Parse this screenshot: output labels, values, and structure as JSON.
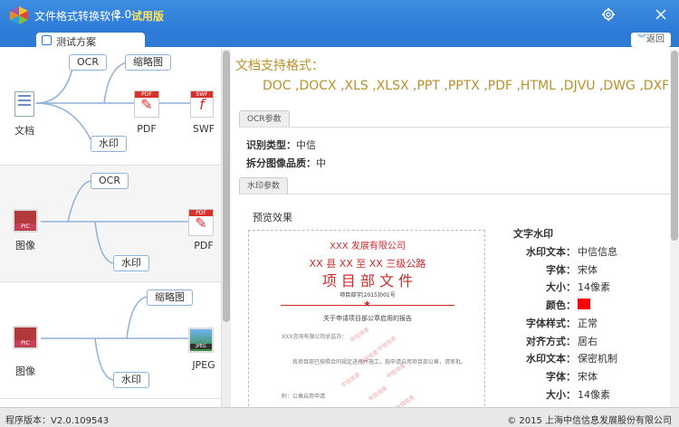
{
  "titlebar": {
    "app_name": "文件格式转换软件",
    "version": "2.0",
    "trial": "试用版",
    "settings_icon": "gear-icon",
    "close_icon": "close-icon"
  },
  "tabs": [
    {
      "label": "测试方案",
      "icon": "document-icon"
    }
  ],
  "back_label": "返回",
  "schemes": [
    {
      "source": "文档",
      "branches": [
        "OCR",
        "缩略图",
        "水印"
      ],
      "targets": [
        "PDF",
        "SWF"
      ]
    },
    {
      "source": "图像",
      "branches": [
        "OCR",
        "水印"
      ],
      "targets": [
        "PDF"
      ]
    },
    {
      "source": "图像",
      "branches": [
        "缩略图",
        "水印"
      ],
      "targets": [
        "JPEG"
      ]
    }
  ],
  "formats": {
    "title": "文档支持格式：",
    "list": "DOC ,DOCX ,XLS ,XLSX ,PPT ,PPTX ,PDF ,HTML ,DJVU ,DWG ,DXF"
  },
  "ocr": {
    "tab_label": "OCR参数",
    "type_label": "识别类型：",
    "type_value": "中信",
    "split_label": "拆分图像品质：",
    "split_value": "中"
  },
  "watermark": {
    "tab_label": "水印参数",
    "preview_label": "预览效果",
    "panel_title": "文字水印",
    "rows": [
      {
        "key": "水印文本：",
        "value": "中信信息"
      },
      {
        "key": "字体：",
        "value": "宋体"
      },
      {
        "key": "大小：",
        "value": "14像素"
      },
      {
        "key": "颜色：",
        "value": ""
      },
      {
        "key": "字体样式：",
        "value": "正常"
      },
      {
        "key": "对齐方式：",
        "value": "居右"
      },
      {
        "key": "水印文本：",
        "value": "保密机制"
      },
      {
        "key": "字体：",
        "value": "宋体"
      },
      {
        "key": "大小：",
        "value": "14像素"
      }
    ],
    "color_swatch": "#ff0000"
  },
  "preview_doc": {
    "company": "XXX 发展有限公司",
    "project_line": "XX 县 XX 至 XX 三级公路",
    "heading": "项 目 部 文 件",
    "doc_number": "项目部字[2015]001号",
    "subject": "关于申请项目部公章启用的报告",
    "to": "XXX咨询有限公司总监办：",
    "body": "我项目部已按照合同规定进场并施工，现申请启用项目部公章，请审批。",
    "note": "附：公章启用申请",
    "watermark_text": "中信信息"
  },
  "status": {
    "left": "程序版本：V2.0.109543",
    "right": "© 2015 上海中信信息发展股份有限公司"
  },
  "colors": {
    "titlebar": "#2d7bd6",
    "accent_text": "#b8912b",
    "doc_red": "#d02a2a"
  }
}
